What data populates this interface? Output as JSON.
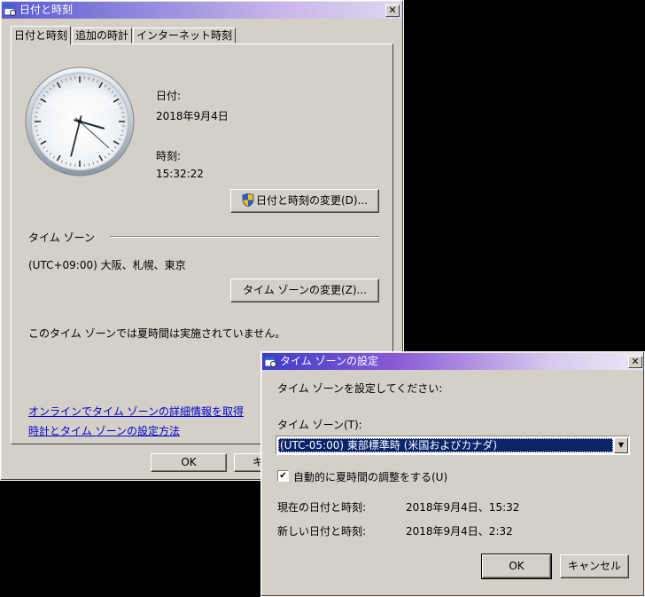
{
  "main_window": {
    "title": "日付と時刻",
    "tabs": [
      {
        "label": "日付と時刻"
      },
      {
        "label": "追加の時計"
      },
      {
        "label": "インターネット時刻"
      }
    ],
    "date_label": "日付:",
    "date_value": "2018年9月4日",
    "time_label": "時刻:",
    "time_value": "15:32:22",
    "change_datetime_button": "日付と時刻の変更(D)...",
    "timezone_section": "タイム ゾーン",
    "timezone_value": "(UTC+09:00) 大阪、札幌、東京",
    "change_timezone_button": "タイム ゾーンの変更(Z)...",
    "dst_note": "このタイム ゾーンでは夏時間は実施されていません。",
    "link_online": "オンラインでタイム ゾーンの詳細情報を取得",
    "link_settings": "時計とタイム ゾーンの設定方法",
    "ok_button": "OK",
    "cancel_button_partial": "キ"
  },
  "tz_dialog": {
    "title": "タイム ゾーンの設定",
    "instruction": "タイム ゾーンを設定してください:",
    "tz_label": "タイム ゾーン(T):",
    "tz_selected": "(UTC-05:00) 東部標準時 (米国およびカナダ)",
    "dst_checkbox_label": "自動的に夏時間の調整をする(U)",
    "dst_checked": true,
    "current_label": "現在の日付と時刻:",
    "current_value": "2018年9月4日、15:32",
    "new_label": "新しい日付と時刻:",
    "new_value": "2018年9月4日、2:32",
    "ok_button": "OK",
    "cancel_button": "キャンセル"
  },
  "colors": {
    "title_gradient_start": "#3c3cc8",
    "title_gradient_end": "#c8a0e6",
    "selection": "#0a246a",
    "link": "#0000cc"
  },
  "clock": {
    "hours": 15,
    "minutes": 32,
    "seconds": 22
  }
}
